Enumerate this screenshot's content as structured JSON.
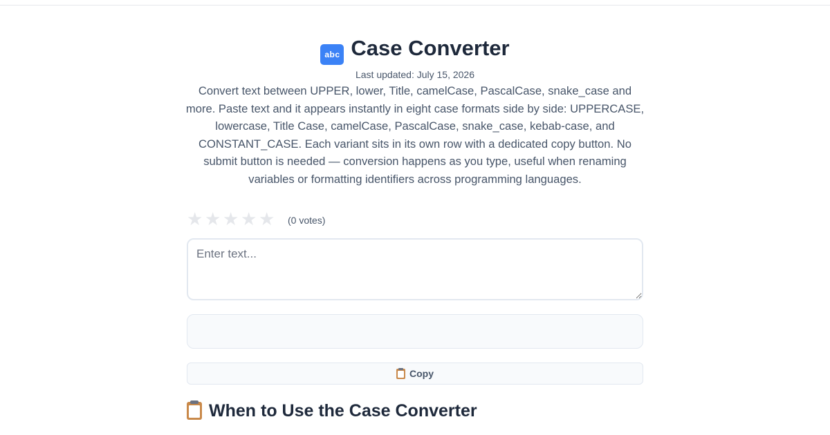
{
  "header": {
    "icon_label": "abc",
    "title": "Case Converter",
    "updated": "Last updated: July 15, 2026",
    "description": "Convert text between UPPER, lower, Title, camelCase, PascalCase, snake_case and more. Paste text and it appears instantly in eight case formats side by side: UPPERCASE, lowercase, Title Case, camelCase, PascalCase, snake_case, kebab-case, and CONSTANT_CASE. Each variant sits in its own row with a dedicated copy button. No submit button is needed — conversion happens as you type, useful when renaming variables or formatting identifiers across programming languages."
  },
  "rating": {
    "stars": [
      "★",
      "★",
      "★",
      "★",
      "★"
    ],
    "value": 0,
    "votes_label": "(0 votes)",
    "star_color": "#e5e7eb"
  },
  "converter": {
    "input_value": "",
    "input_placeholder": "Enter text...",
    "output_value": "",
    "copy_label": "Copy",
    "copy_icon": "clipboard-icon"
  },
  "section": {
    "icon": "clipboard-icon",
    "title": "When to Use the Case Converter"
  },
  "colors": {
    "title": "#1e293b",
    "muted": "#475569",
    "border": "#e2e8f0",
    "output_bg": "#f8fafc"
  }
}
